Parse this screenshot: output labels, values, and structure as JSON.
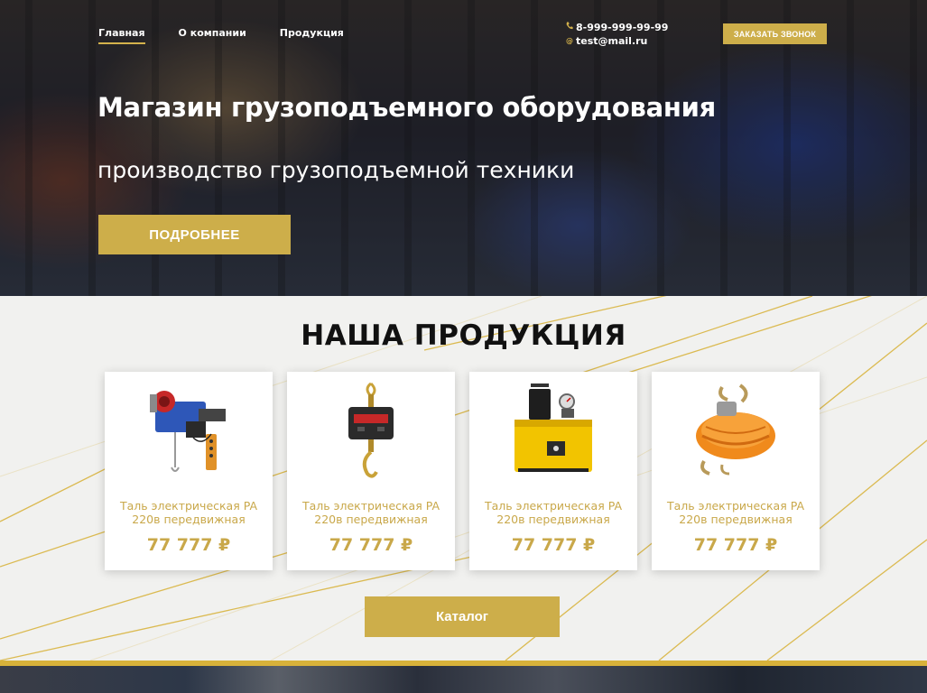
{
  "nav": {
    "items": [
      {
        "label": "Главная",
        "active": true
      },
      {
        "label": "О компании",
        "active": false
      },
      {
        "label": "Продукция",
        "active": false
      }
    ]
  },
  "contacts": {
    "phone": "8-999-999-99-99",
    "email": "test@mail.ru",
    "phone_icon": "phone-icon",
    "email_icon": "at-icon"
  },
  "header": {
    "call_button": "ЗАКАЗАТЬ ЗВОНОК"
  },
  "hero": {
    "title": "Магазин грузоподъемного оборудования",
    "subtitle": "производство грузоподъемной техники",
    "more_button": "ПОДРОБНЕЕ"
  },
  "products": {
    "title": "НАША ПРОДУКЦИЯ",
    "items": [
      {
        "name": "Таль электрическая PA 220в передвижная",
        "price": "77 777 ₽",
        "image": "electric-hoist"
      },
      {
        "name": "Таль электрическая PA 220в передвижная",
        "price": "77 777 ₽",
        "image": "crane-scale"
      },
      {
        "name": "Таль электрическая PA 220в передвижная",
        "price": "77 777 ₽",
        "image": "hydraulic-pump"
      },
      {
        "name": "Таль электрическая PA 220в передвижная",
        "price": "77 777 ₽",
        "image": "ratchet-straps"
      }
    ],
    "catalog_button": "Каталог"
  },
  "colors": {
    "accent": "#cdae4a",
    "price": "#c9a84a",
    "title": "#111111",
    "section_bg": "#f1f1ef"
  }
}
